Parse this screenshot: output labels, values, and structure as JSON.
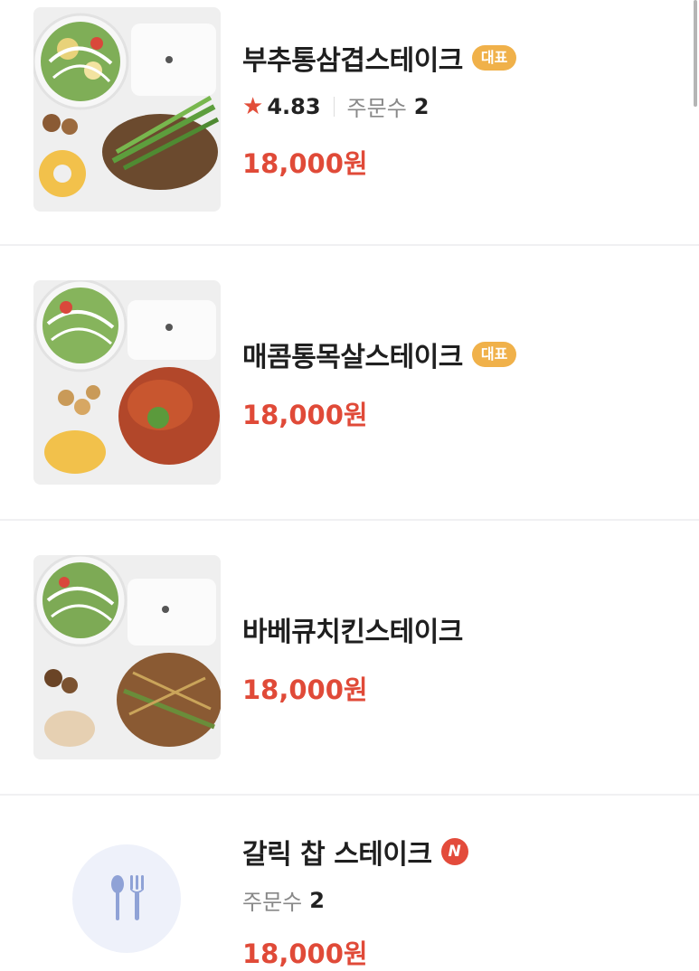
{
  "menu": [
    {
      "name": "부추통삼겹스테이크",
      "badge": "대표",
      "rating_star": "★",
      "rating": "4.83",
      "orders_label": "주문수",
      "orders_count": "2",
      "price": "18,000원",
      "image": "pork-belly-chive-steak-plate"
    },
    {
      "name": "매콤통목살스테이크",
      "badge": "대표",
      "price": "18,000원",
      "image": "spicy-pork-neck-steak-plate"
    },
    {
      "name": "바베큐치킨스테이크",
      "price": "18,000원",
      "image": "bbq-chicken-steak-plate"
    },
    {
      "name": "갈릭 찹 스테이크",
      "new_badge": "N",
      "orders_label": "주문수",
      "orders_count": "2",
      "price": "18,000원",
      "image_placeholder_icon": "fork-spoon-icon"
    }
  ],
  "colors": {
    "price": "#e04a38",
    "badge": "#f0b14a",
    "new_badge": "#e34b3b",
    "star": "#e24d39"
  }
}
